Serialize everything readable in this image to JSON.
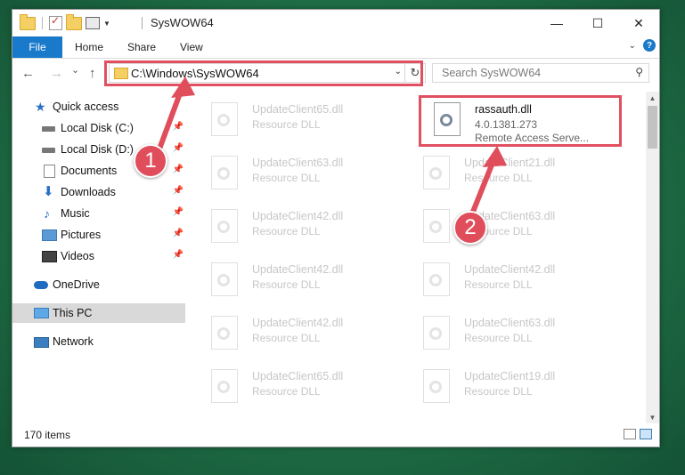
{
  "window": {
    "title": "SysWOW64",
    "controls": {
      "minimize": "—",
      "maximize": "☐",
      "close": "✕"
    }
  },
  "ribbon": {
    "tabs": [
      "File",
      "Home",
      "Share",
      "View"
    ]
  },
  "navbar": {
    "back": "←",
    "forward": "→",
    "recent": "⌄",
    "up": "↑",
    "address": "C:\\Windows\\SysWOW64",
    "search_placeholder": "Search SysWOW64"
  },
  "sidebar": {
    "items": [
      {
        "label": "Quick access",
        "icon": "star-icon"
      },
      {
        "label": "Local Disk (C:)",
        "icon": "disk-icon",
        "pinned": true
      },
      {
        "label": "Local Disk (D:)",
        "icon": "disk-icon",
        "pinned": true
      },
      {
        "label": "Documents",
        "icon": "documents-icon",
        "pinned": true
      },
      {
        "label": "Downloads",
        "icon": "download-icon",
        "pinned": true
      },
      {
        "label": "Music",
        "icon": "music-icon",
        "pinned": true
      },
      {
        "label": "Pictures",
        "icon": "pictures-icon",
        "pinned": true
      },
      {
        "label": "Videos",
        "icon": "videos-icon",
        "pinned": true
      },
      {
        "label": "OneDrive",
        "icon": "cloud-icon"
      },
      {
        "label": "This PC",
        "icon": "computer-icon",
        "selected": true
      },
      {
        "label": "Network",
        "icon": "network-icon"
      }
    ]
  },
  "files": {
    "left": [
      {
        "name": "UpdateClient65.dll",
        "desc": "Resource DLL"
      },
      {
        "name": "UpdateClient63.dll",
        "desc": "Resource DLL"
      },
      {
        "name": "UpdateClient42.dll",
        "desc": "Resource DLL"
      },
      {
        "name": "UpdateClient42.dll",
        "desc": "Resource DLL"
      },
      {
        "name": "UpdateClient42.dll",
        "desc": "Resource DLL"
      },
      {
        "name": "UpdateClient65.dll",
        "desc": "Resource DLL"
      }
    ],
    "highlighted": {
      "name": "rassauth.dll",
      "version": "4.0.1381.273",
      "desc": "Remote Access Serve..."
    },
    "right": [
      {
        "name": "UpdateClient21.dll",
        "desc": "Resource DLL"
      },
      {
        "name": "UpdateClient63.dll",
        "desc": "Resource DLL"
      },
      {
        "name": "UpdateClient42.dll",
        "desc": "Resource DLL"
      },
      {
        "name": "UpdateClient63.dll",
        "desc": "Resource DLL"
      },
      {
        "name": "UpdateClient19.dll",
        "desc": "Resource DLL"
      }
    ]
  },
  "status": {
    "item_count": "170 items"
  },
  "annotations": {
    "step1": "1",
    "step2": "2",
    "color": "#e04e5c"
  }
}
